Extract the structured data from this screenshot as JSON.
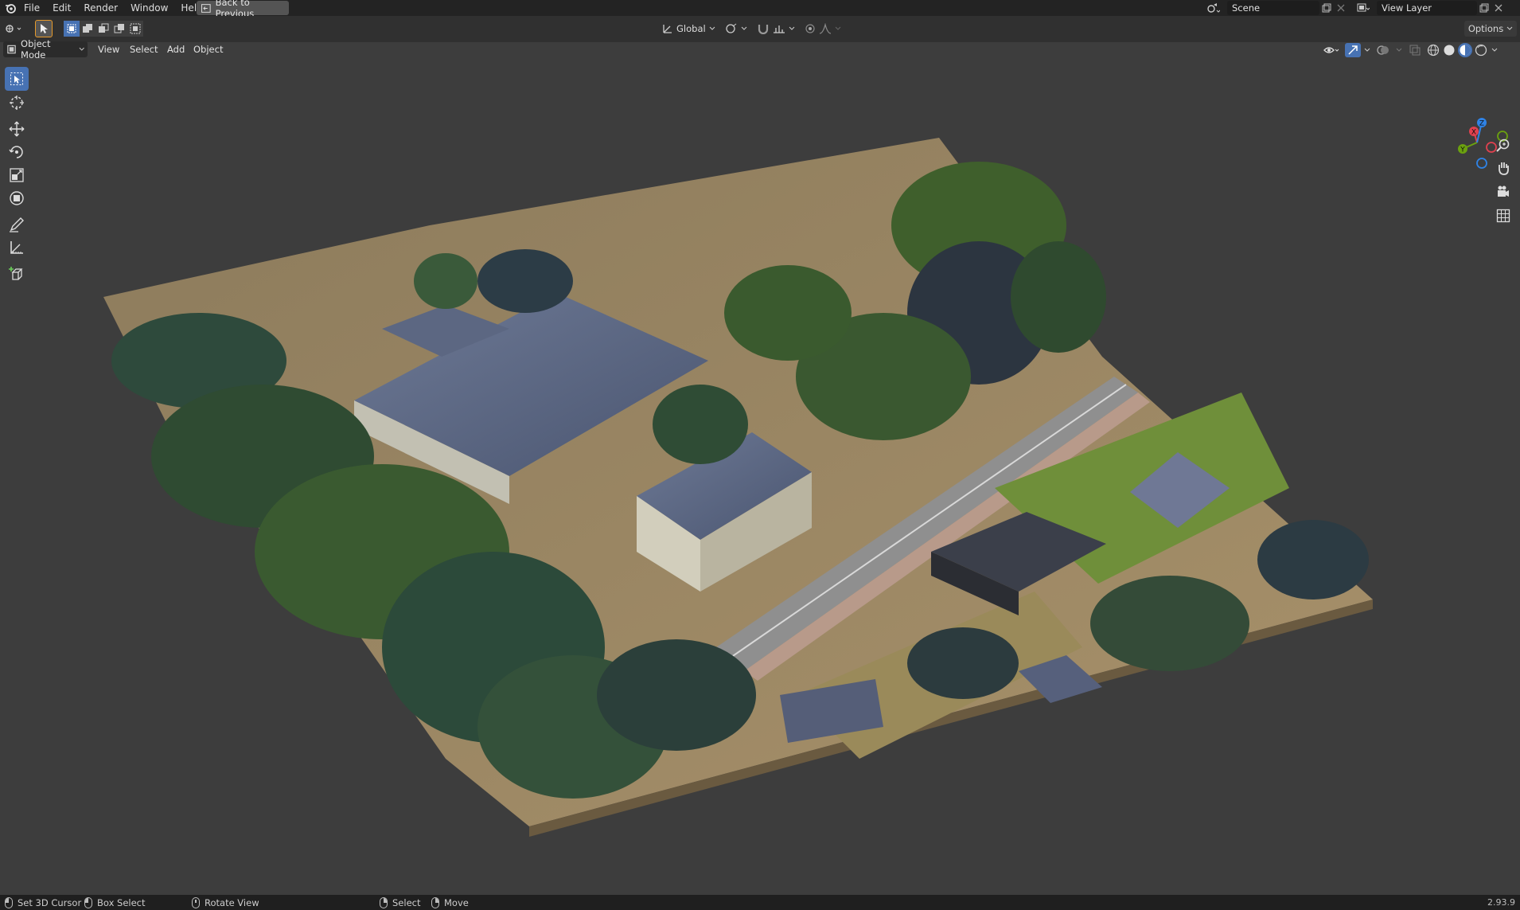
{
  "topbar": {
    "menus": [
      "File",
      "Edit",
      "Render",
      "Window",
      "Help"
    ],
    "back_button": "Back to Previous",
    "scene_name": "Scene",
    "view_layer_name": "View Layer"
  },
  "header": {
    "transform_orientation": "Global",
    "options_label": "Options"
  },
  "viewport_header": {
    "mode": "Object Mode",
    "menus": [
      "View",
      "Select",
      "Add",
      "Object"
    ]
  },
  "toolbar": {
    "tools": [
      "select-box",
      "cursor",
      "move",
      "rotate",
      "scale",
      "transform",
      "annotate",
      "measure",
      "add-cube"
    ],
    "active_tool": "select-box"
  },
  "gizmo": {
    "axes": [
      "X",
      "Y",
      "Z"
    ]
  },
  "statusbar": {
    "items": [
      "Set 3D Cursor",
      "Box Select",
      "Rotate View",
      "Select",
      "Move"
    ],
    "version": "2.93.9"
  },
  "colors": {
    "accent_blue": "#4772b3",
    "active_orange": "#e69a2b",
    "axis_x": "#e0414f",
    "axis_y": "#6ba10f",
    "axis_z": "#2f83e6"
  }
}
